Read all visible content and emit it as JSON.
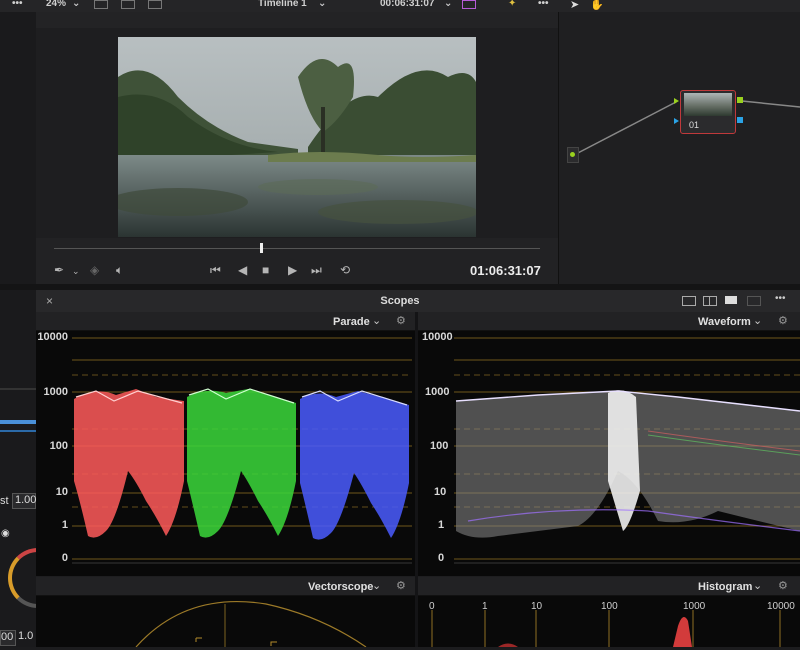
{
  "toolbar": {
    "zoom": "24%",
    "timeline_name": "Timeline 1",
    "timecode": "00:06:31:07",
    "menu_dots": "•••"
  },
  "viewer": {
    "timecode": "01:06:31:07"
  },
  "node_editor": {
    "node_label": "01"
  },
  "scopes": {
    "title": "Scopes",
    "close": "×",
    "more": "•••",
    "parade_title": "Parade",
    "waveform_title": "Waveform",
    "vectorscope_title": "Vectorscope",
    "histogram_title": "Histogram",
    "parade_scale": [
      "10000",
      "1000",
      "100",
      "10",
      "1",
      "0"
    ],
    "waveform_scale": [
      "10000",
      "1000",
      "100",
      "10",
      "1",
      "0"
    ],
    "histogram_scale": [
      "0",
      "1",
      "10",
      "100",
      "1000",
      "10000"
    ]
  },
  "left_panel": {
    "label_st": "st",
    "value_1": "1.00",
    "value_2": "00",
    "value_3": "1.0"
  },
  "colors": {
    "red_channel": "#ff5a5a",
    "green_channel": "#3bd83b",
    "blue_channel": "#4a5cff",
    "graticule": "#b28a2a",
    "node_border": "#c0393b"
  },
  "icons": [
    "chevron-down-icon",
    "eyedropper-icon",
    "layers-icon",
    "speaker-icon",
    "skip-back-icon",
    "step-back-icon",
    "stop-icon",
    "play-icon",
    "skip-forward-icon",
    "loop-icon",
    "pointer-icon",
    "hand-icon",
    "settings-icon",
    "layout-single-icon",
    "layout-dual-icon",
    "layout-quad-icon",
    "layout-grid-icon"
  ]
}
